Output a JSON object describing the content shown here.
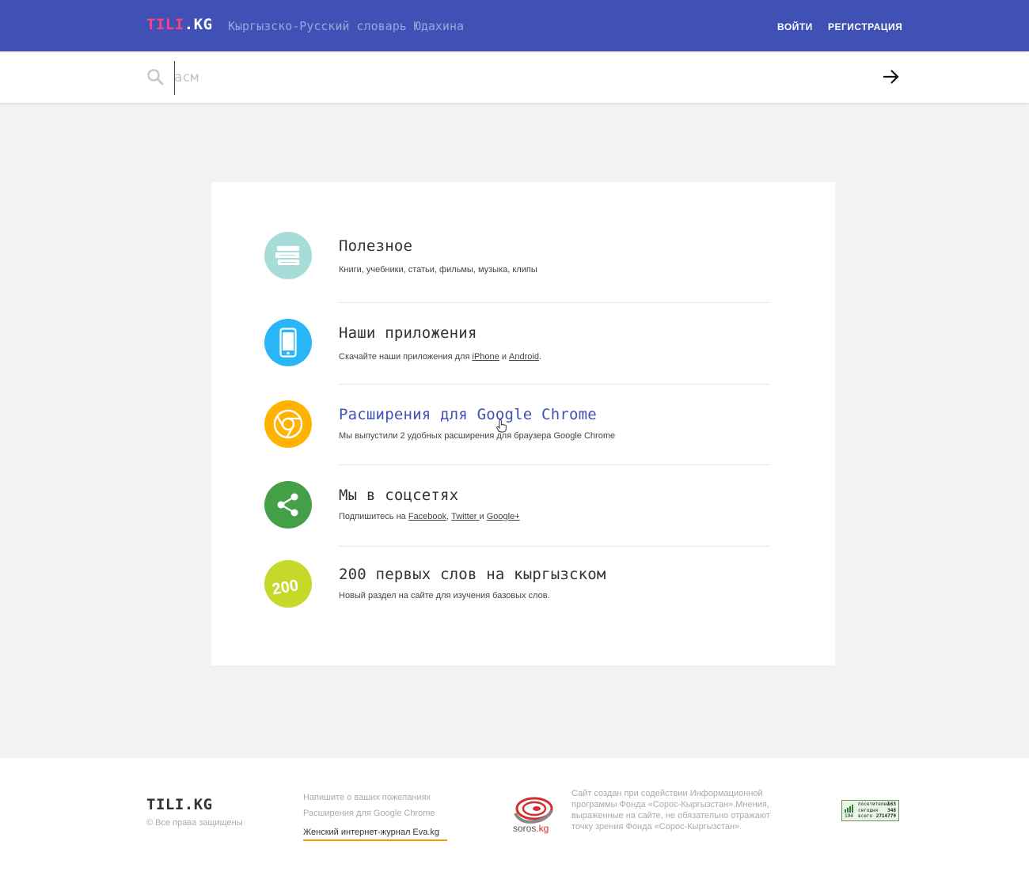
{
  "header": {
    "logo_part1": "TILI",
    "logo_part2": ".KG",
    "subtitle": "Кыргызско-Русский словарь Юдахина",
    "login_label": "ВОЙТИ",
    "register_label": "РЕГИСТРАЦИЯ"
  },
  "search": {
    "placeholder": "асм",
    "value": ""
  },
  "items": [
    {
      "title": "Полезное",
      "desc": "Книги, учебники, статьи, фильмы, музыка, клипы",
      "icon": "books-icon",
      "color": "#a7dcd9"
    },
    {
      "title": "Наши приложения",
      "desc_prefix": "Скачайте наши приложения для ",
      "link1": "iPhone",
      "desc_mid": " и ",
      "link2": "Android",
      "desc_suffix": ".",
      "icon": "smartphone-icon",
      "color": "#29b6f6"
    },
    {
      "title": "Расширения для Google Chrome",
      "desc": "Мы выпустили 2 удобных расширения для браузера Google Chrome",
      "icon": "chrome-icon",
      "color": "#ffb300"
    },
    {
      "title": "Мы в соцсетях",
      "desc_prefix": "Подпишитесь на ",
      "link1": "Facebook",
      "sep1": ", ",
      "link2": "Twitter ",
      "sep2": "и ",
      "link3": "Google+",
      "icon": "share-icon",
      "color": "#43a047"
    },
    {
      "title": "200 первых слов на кыргызском",
      "desc": "Новый раздел на сайте для изучения базовых слов.",
      "icon": "badge-200-icon",
      "badge_text": "200",
      "color": "#c6d92b"
    }
  ],
  "footer": {
    "logo": "TILI.KG",
    "copyright": "© Все права защищены",
    "links": [
      "Напишите о ваших пожеланиях",
      "Расширения для Google Chrome",
      "Женский интернет-журнал Eva.kg"
    ],
    "soros_name": "soros",
    "soros_tld": ".kg",
    "about": "Сайт создан при содействии Информационной программы Фонда «Сорос-Кыргызстан».Мнения, выраженные на сайте, не обязательно отражают точку зрения Фонда «Сорос-Кыргызстан».",
    "counter": {
      "label1": "посетителей",
      "label2": "сегодня",
      "label3": "194",
      "label4": "всего",
      "value1": "163",
      "value2": "348",
      "value3": "2714779"
    }
  },
  "colors": {
    "header_bg": "#3f51b5",
    "logo_accent": "#ff4081",
    "link_accent": "#3f51b5",
    "footer_underline": "#ff9800"
  }
}
